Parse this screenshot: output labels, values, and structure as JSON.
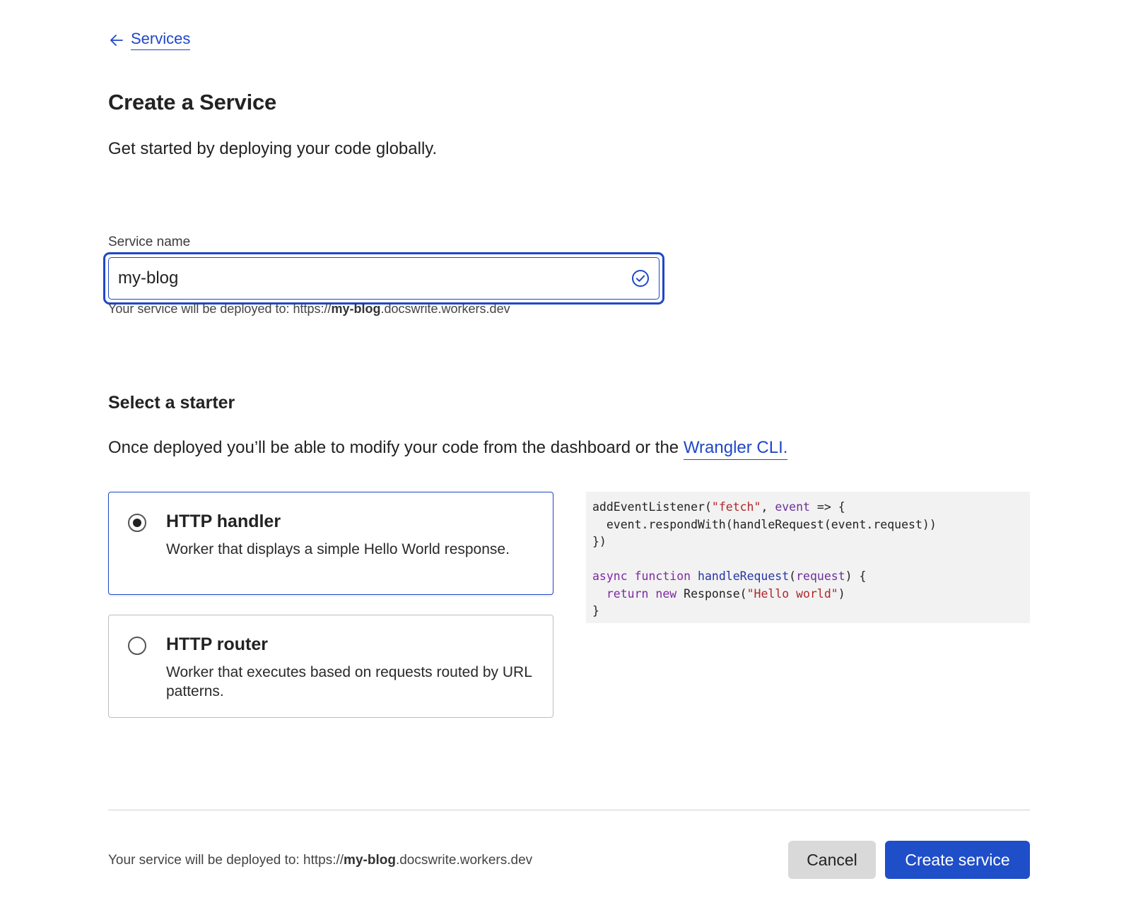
{
  "nav": {
    "back_label": "Services"
  },
  "header": {
    "title": "Create a Service",
    "subtitle": "Get started by deploying your code globally."
  },
  "service_name": {
    "label": "Service name",
    "value": "my-blog",
    "hint_prefix": "Your service will be deployed to: https://",
    "hint_name": "my-blog",
    "hint_suffix": ".docswrite.workers.dev"
  },
  "starter": {
    "title": "Select a starter",
    "description": "Once deployed you’ll be able to modify your code from the dashboard or the ",
    "link_label": "Wrangler CLI.",
    "options": [
      {
        "title": "HTTP handler",
        "description": "Worker that displays a simple Hello World response.",
        "selected": true
      },
      {
        "title": "HTTP router",
        "description": "Worker that executes based on requests routed by URL patterns.",
        "selected": false
      }
    ]
  },
  "code": {
    "l1_fn": "addEventListener(",
    "l1_str": "\"fetch\"",
    "l1_sep": ", ",
    "l1_var": "event",
    "l1_end": " => {",
    "l2": "  event.respondWith(handleRequest(event.request))",
    "l3": "})",
    "l5_kw1": "async",
    "l5_kw2": "function",
    "l5_fn": "handleRequest",
    "l5_open": "(",
    "l5_var": "request",
    "l5_end": ") {",
    "l6_kw1": "return",
    "l6_kw2": "new",
    "l6_mid": " Response(",
    "l6_str": "\"Hello world\"",
    "l6_end": ")",
    "l7": "}"
  },
  "footer": {
    "hint_prefix": "Your service will be deployed to: https://",
    "hint_name": "my-blog",
    "hint_suffix": ".docswrite.workers.dev",
    "cancel_label": "Cancel",
    "create_label": "Create service"
  },
  "colors": {
    "accent": "#1f47c7",
    "primary_button": "#1f4ec9",
    "secondary_button": "#d9d9d9"
  }
}
